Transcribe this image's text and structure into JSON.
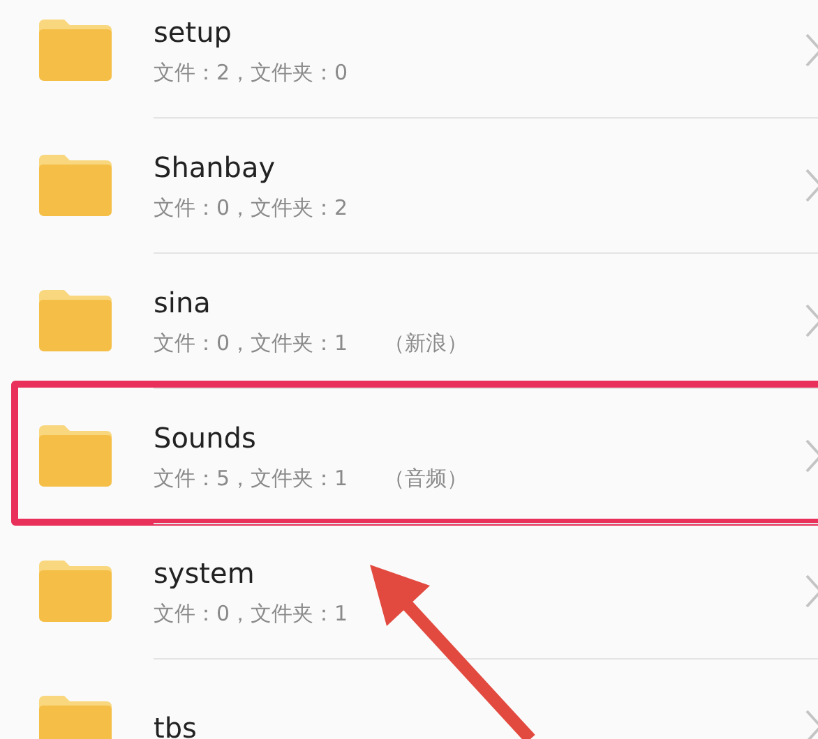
{
  "rows": [
    {
      "name": "setup",
      "meta": "文件：2，文件夹：0",
      "highlighted": false
    },
    {
      "name": "Shanbay",
      "meta": "文件：0，文件夹：2",
      "highlighted": false
    },
    {
      "name": "sina",
      "meta": "文件：0，文件夹：1",
      "note": "（新浪）",
      "highlighted": false
    },
    {
      "name": "Sounds",
      "meta": "文件：5，文件夹：1",
      "note": "（音频）",
      "highlighted": true
    },
    {
      "name": "system",
      "meta": "文件：0，文件夹：1",
      "highlighted": false
    },
    {
      "name": "tbs",
      "highlighted": false
    }
  ]
}
